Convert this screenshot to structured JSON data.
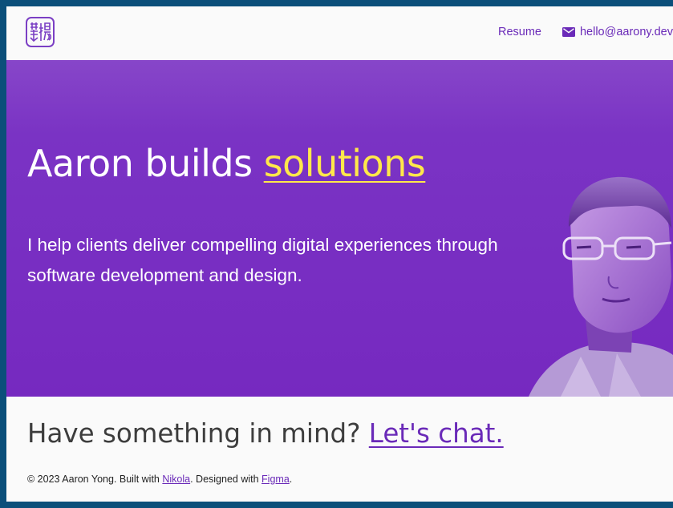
{
  "header": {
    "logo_text": "翻杨",
    "nav": {
      "resume_label": "Resume",
      "email_label": "hello@aarony.dev"
    }
  },
  "hero": {
    "title_prefix": "Aaron builds ",
    "title_highlight": "solutions",
    "subtitle": "I help clients deliver compelling digital experiences through software development and design."
  },
  "cta": {
    "text": "Have something in mind? ",
    "link_label": "Let's chat."
  },
  "footer": {
    "copy_prefix": "© 2023 Aaron Yong. Built with ",
    "nikola_label": "Nikola",
    "copy_mid": ". Designed with ",
    "figma_label": "Figma",
    "copy_suffix": "."
  },
  "colors": {
    "accent_purple": "#7629c0",
    "highlight_yellow": "#ffe84a",
    "link_purple": "#6a2ab8"
  },
  "icons": [
    "logo-seal-icon",
    "mail-icon"
  ]
}
